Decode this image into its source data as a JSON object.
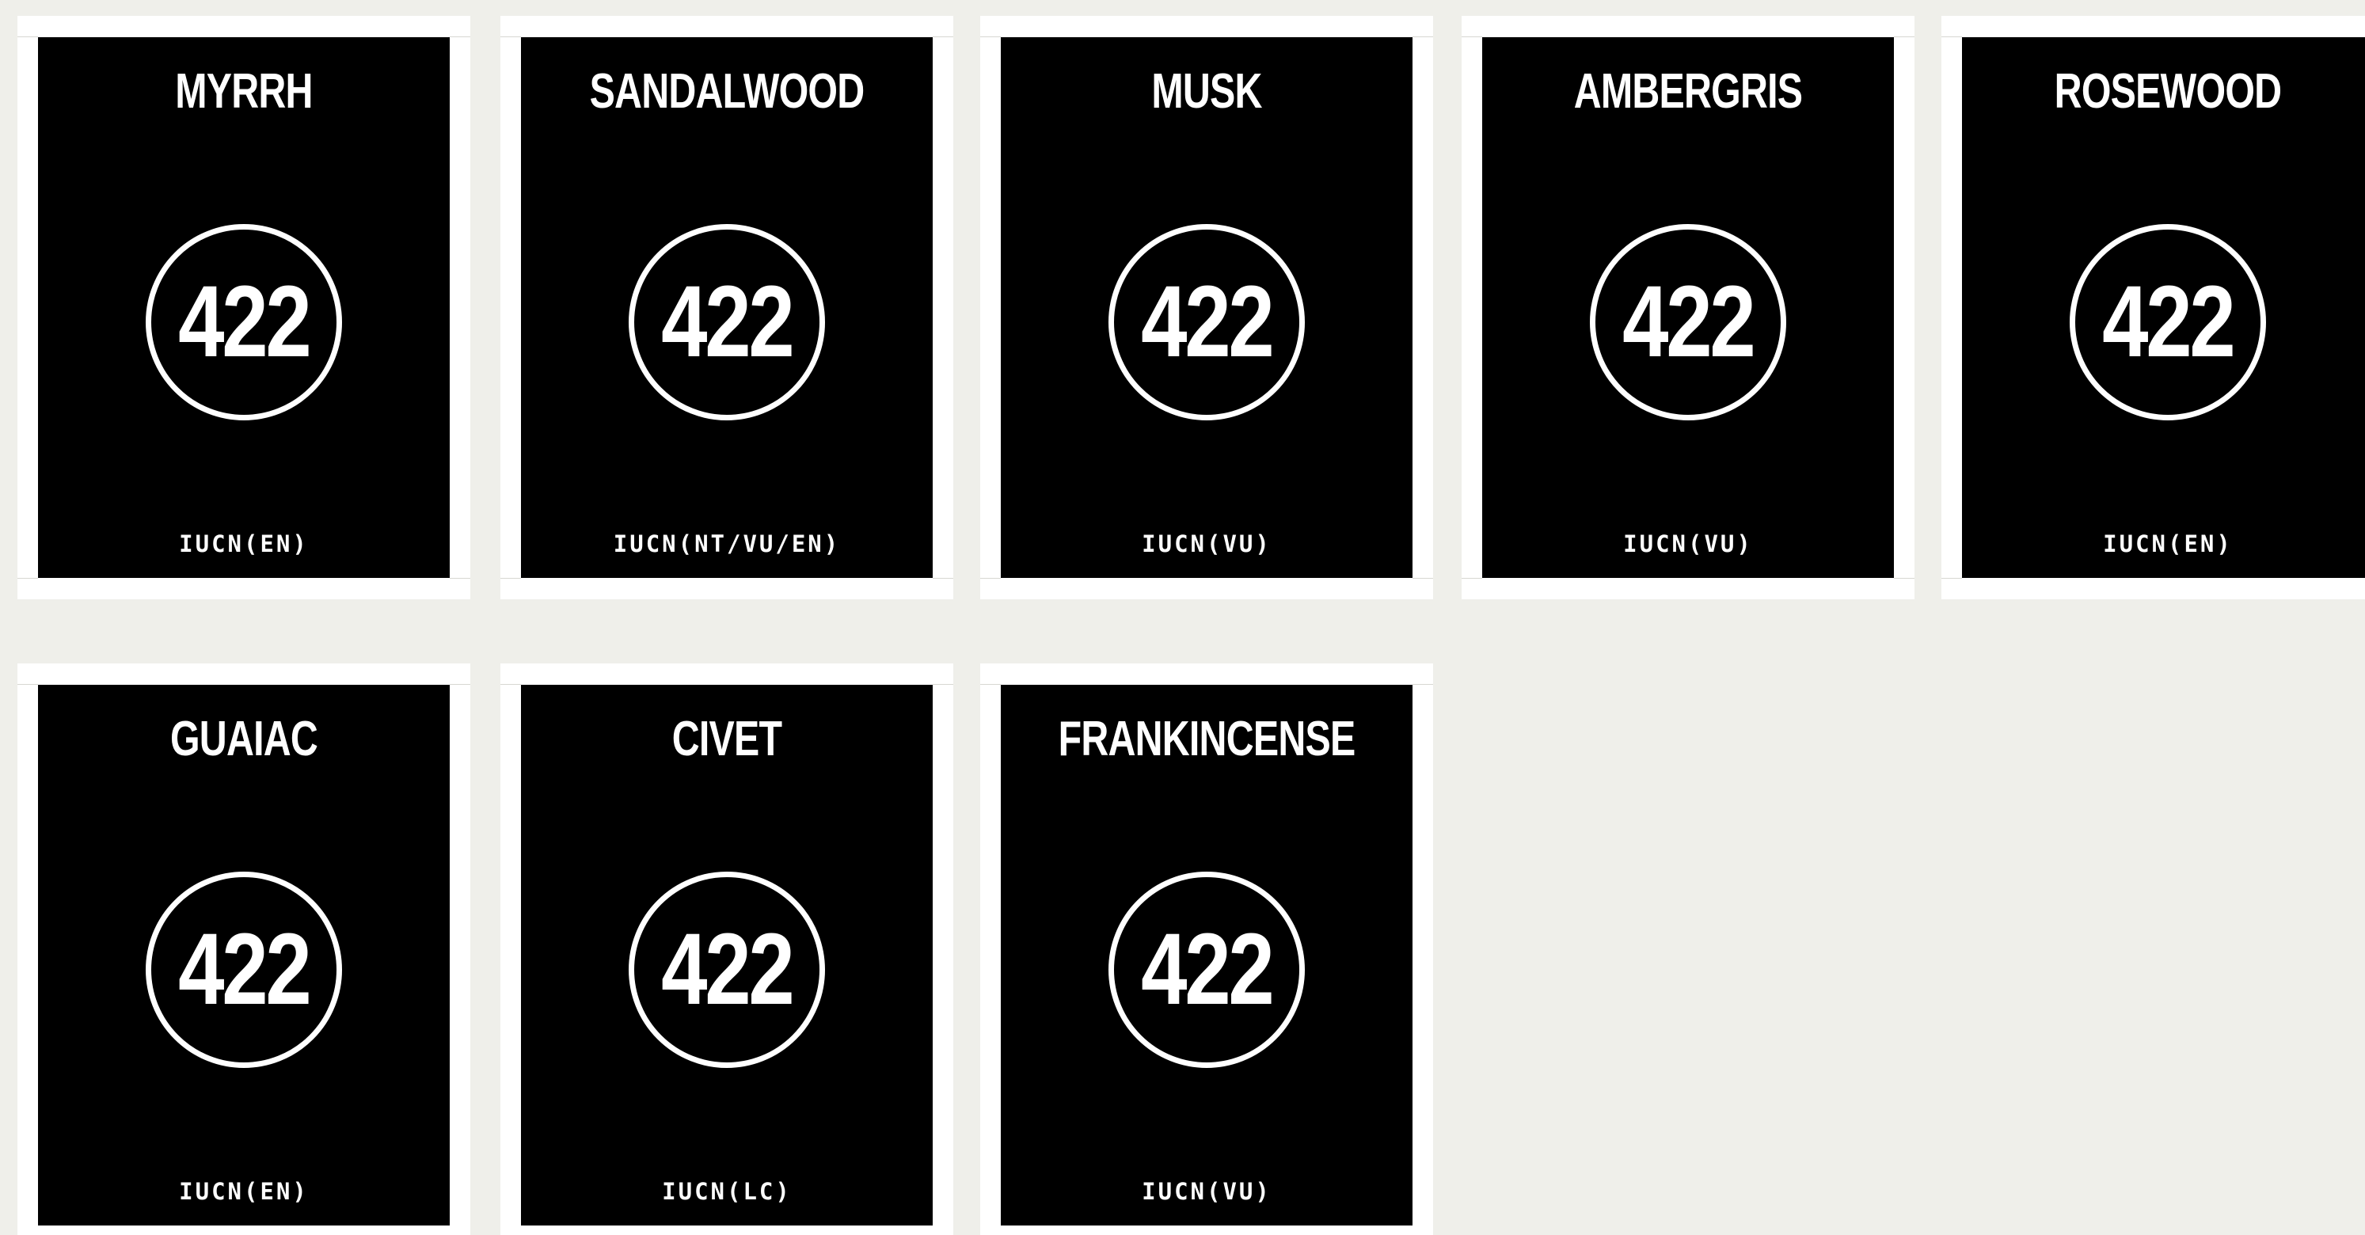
{
  "background_color": "#efefea",
  "card_color": "#000000",
  "text_color": "#ffffff",
  "labels": [
    {
      "name": "MYRRH",
      "number": "422",
      "status": "IUCN(EN)"
    },
    {
      "name": "SANDALWOOD",
      "number": "422",
      "status": "IUCN(NT/VU/EN)"
    },
    {
      "name": "MUSK",
      "number": "422",
      "status": "IUCN(VU)"
    },
    {
      "name": "AMBERGRIS",
      "number": "422",
      "status": "IUCN(VU)"
    },
    {
      "name": "ROSEWOOD",
      "number": "422",
      "status": "IUCN(EN)"
    },
    {
      "name": "GUAIAC",
      "number": "422",
      "status": "IUCN(EN)"
    },
    {
      "name": "CIVET",
      "number": "422",
      "status": "IUCN(LC)"
    },
    {
      "name": "FRANKINCENSE",
      "number": "422",
      "status": "IUCN(VU)"
    }
  ]
}
